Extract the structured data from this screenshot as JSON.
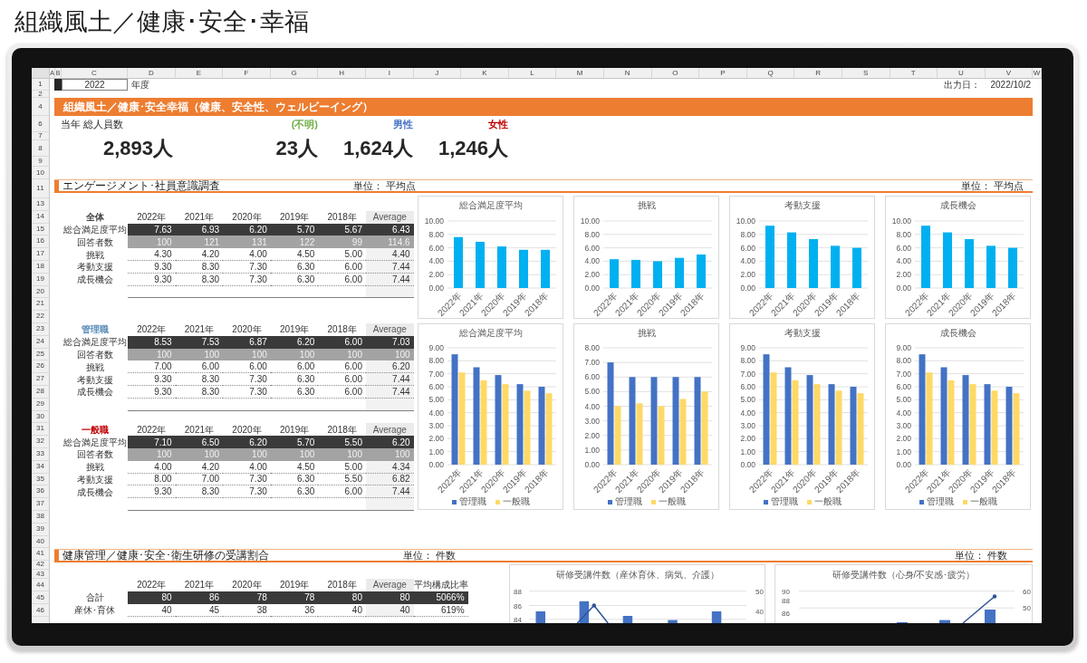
{
  "page_title": "組織風土／健康･安全･幸福",
  "sheet": {
    "columns": [
      "A",
      "B",
      "C",
      "D",
      "E",
      "F",
      "G",
      "H",
      "I",
      "J",
      "K",
      "L",
      "M",
      "N",
      "O",
      "P",
      "Q",
      "R",
      "S",
      "T",
      "U",
      "V",
      "W"
    ],
    "rows": [
      "1",
      "2",
      "4",
      "6",
      "7",
      "8",
      "9",
      "10",
      "11",
      "13",
      "14",
      "15",
      "16",
      "17",
      "18",
      "19",
      "20",
      "21",
      "22",
      "23",
      "24",
      "25",
      "26",
      "27",
      "28",
      "29",
      "30",
      "31",
      "32",
      "33",
      "34",
      "35",
      "36",
      "37",
      "38",
      "39",
      "40",
      "41",
      "42",
      "43",
      "44",
      "45",
      "46"
    ],
    "year": "2022",
    "year_label": "年度",
    "output_date_label": "出力日：",
    "output_date": "2022/10/2",
    "banner": "組織風土／健康･安全幸福（健康、安全性、ウェルビーイング）",
    "headcount": [
      {
        "kind": "total",
        "label": "当年 総人員数",
        "value": "2,893人"
      },
      {
        "kind": "group",
        "label": "(不明)",
        "value": "23人",
        "color": "#70ad47"
      },
      {
        "kind": "group",
        "label": "男性",
        "value": "1,624人",
        "color": "#4472c4"
      },
      {
        "kind": "group",
        "label": "女性",
        "value": "1,246人",
        "color": "#c00000"
      }
    ],
    "sections": [
      {
        "title": "エンゲージメント･社員意識調査",
        "units": [
          "単位： 平均点",
          "単位： 平均点"
        ],
        "tables": [
          {
            "label": "全体",
            "color": "#404040",
            "footer_rule": true,
            "columns": [
              {
                "label": "2022年",
                "shaded": false
              },
              {
                "label": "2021年",
                "shaded": false
              },
              {
                "label": "2020年",
                "shaded": false
              },
              {
                "label": "2019年",
                "shaded": false
              },
              {
                "label": "2018年",
                "shaded": false
              },
              {
                "label": "Average",
                "shaded": true
              }
            ],
            "rows": [
              {
                "kind": "total",
                "label": "総合満足度平均",
                "cells": [
                  "7.63",
                  "6.93",
                  "6.20",
                  "5.70",
                  "5.67",
                  "6.43"
                ]
              },
              {
                "kind": "count",
                "label": "回答者数",
                "cells": [
                  "100",
                  "121",
                  "131",
                  "122",
                  "99",
                  "114.6"
                ]
              },
              {
                "kind": "item",
                "label": "挑戦",
                "cells": [
                  "4.30",
                  "4.20",
                  "4.00",
                  "4.50",
                  "5.00",
                  "4.40"
                ]
              },
              {
                "kind": "item",
                "label": "考動支援",
                "cells": [
                  "9.30",
                  "8.30",
                  "7.30",
                  "6.30",
                  "6.00",
                  "7.44"
                ]
              },
              {
                "kind": "item",
                "label": "成長機会",
                "cells": [
                  "9.30",
                  "8.30",
                  "7.30",
                  "6.30",
                  "6.00",
                  "7.44"
                ]
              }
            ]
          },
          {
            "label": "管理職",
            "color": "#5b8db8",
            "footer_rule": true,
            "columns": [
              {
                "label": "2022年",
                "shaded": false
              },
              {
                "label": "2021年",
                "shaded": false
              },
              {
                "label": "2020年",
                "shaded": false
              },
              {
                "label": "2019年",
                "shaded": false
              },
              {
                "label": "2018年",
                "shaded": false
              },
              {
                "label": "Average",
                "shaded": true
              }
            ],
            "rows": [
              {
                "kind": "total",
                "label": "総合満足度平均",
                "cells": [
                  "8.53",
                  "7.53",
                  "6.87",
                  "6.20",
                  "6.00",
                  "7.03"
                ]
              },
              {
                "kind": "count",
                "label": "回答者数",
                "cells": [
                  "100",
                  "100",
                  "100",
                  "100",
                  "100",
                  "100"
                ]
              },
              {
                "kind": "item",
                "label": "挑戦",
                "cells": [
                  "7.00",
                  "6.00",
                  "6.00",
                  "6.00",
                  "6.00",
                  "6.20"
                ]
              },
              {
                "kind": "item",
                "label": "考動支援",
                "cells": [
                  "9.30",
                  "8.30",
                  "7.30",
                  "6.30",
                  "6.00",
                  "7.44"
                ]
              },
              {
                "kind": "item",
                "label": "成長機会",
                "cells": [
                  "9.30",
                  "8.30",
                  "7.30",
                  "6.30",
                  "6.00",
                  "7.44"
                ]
              }
            ]
          },
          {
            "label": "一般職",
            "color": "#c00000",
            "footer_rule": true,
            "columns": [
              {
                "label": "2022年",
                "shaded": false
              },
              {
                "label": "2021年",
                "shaded": false
              },
              {
                "label": "2020年",
                "shaded": false
              },
              {
                "label": "2019年",
                "shaded": false
              },
              {
                "label": "2018年",
                "shaded": false
              },
              {
                "label": "Average",
                "shaded": true
              }
            ],
            "rows": [
              {
                "kind": "total",
                "label": "総合満足度平均",
                "cells": [
                  "7.10",
                  "6.50",
                  "6.20",
                  "5.70",
                  "5.50",
                  "6.20"
                ]
              },
              {
                "kind": "count",
                "label": "回答者数",
                "cells": [
                  "100",
                  "100",
                  "100",
                  "100",
                  "100",
                  "100"
                ]
              },
              {
                "kind": "item",
                "label": "挑戦",
                "cells": [
                  "4.00",
                  "4.20",
                  "4.00",
                  "4.50",
                  "5.00",
                  "4.34"
                ]
              },
              {
                "kind": "item",
                "label": "考動支援",
                "cells": [
                  "8.00",
                  "7.00",
                  "7.30",
                  "6.30",
                  "5.50",
                  "6.82"
                ]
              },
              {
                "kind": "item",
                "label": "成長機会",
                "cells": [
                  "9.30",
                  "8.30",
                  "7.30",
                  "6.30",
                  "6.00",
                  "7.44"
                ]
              }
            ]
          }
        ],
        "charts": [
          {
            "kind": "bar",
            "chart_data": {
              "type": "bar",
              "title": "総合満足度平均",
              "categories": [
                "2022年",
                "2021年",
                "2020年",
                "2019年",
                "2018年"
              ],
              "values": [
                7.6,
                6.9,
                6.2,
                5.7,
                5.7
              ],
              "ylim": [
                0,
                10
              ],
              "yticks": [
                {
                  "value": 0,
                  "label": "0.00"
                },
                {
                  "value": 2,
                  "label": "2.00"
                },
                {
                  "value": 4,
                  "label": "4.00"
                },
                {
                  "value": 6,
                  "label": "6.00"
                },
                {
                  "value": 8,
                  "label": "8.00"
                },
                {
                  "value": 10,
                  "label": "10.00"
                }
              ],
              "grid": true
            }
          },
          {
            "kind": "bar",
            "chart_data": {
              "type": "bar",
              "title": "挑戦",
              "categories": [
                "2022年",
                "2021年",
                "2020年",
                "2019年",
                "2018年"
              ],
              "values": [
                4.3,
                4.2,
                4.0,
                4.5,
                5.0
              ],
              "ylim": [
                0,
                10
              ],
              "yticks": [
                {
                  "value": 0,
                  "label": "0.00"
                },
                {
                  "value": 2,
                  "label": "2.00"
                },
                {
                  "value": 4,
                  "label": "4.00"
                },
                {
                  "value": 6,
                  "label": "6.00"
                },
                {
                  "value": 8,
                  "label": "8.00"
                },
                {
                  "value": 10,
                  "label": "10.00"
                }
              ],
              "grid": true
            }
          },
          {
            "kind": "bar",
            "chart_data": {
              "type": "bar",
              "title": "考動支援",
              "categories": [
                "2022年",
                "2021年",
                "2020年",
                "2019年",
                "2018年"
              ],
              "values": [
                9.3,
                8.3,
                7.3,
                6.3,
                6.0
              ],
              "ylim": [
                0,
                10
              ],
              "yticks": [
                {
                  "value": 0,
                  "label": "0.00"
                },
                {
                  "value": 2,
                  "label": "2.00"
                },
                {
                  "value": 4,
                  "label": "4.00"
                },
                {
                  "value": 6,
                  "label": "6.00"
                },
                {
                  "value": 8,
                  "label": "8.00"
                },
                {
                  "value": 10,
                  "label": "10.00"
                }
              ],
              "grid": true
            }
          },
          {
            "kind": "bar",
            "chart_data": {
              "type": "bar",
              "title": "成長機会",
              "categories": [
                "2022年",
                "2021年",
                "2020年",
                "2019年",
                "2018年"
              ],
              "values": [
                9.3,
                8.3,
                7.3,
                6.3,
                6.0
              ],
              "ylim": [
                0,
                10
              ],
              "yticks": [
                {
                  "value": 0,
                  "label": "0.00"
                },
                {
                  "value": 2,
                  "label": "2.00"
                },
                {
                  "value": 4,
                  "label": "4.00"
                },
                {
                  "value": 6,
                  "label": "6.00"
                },
                {
                  "value": 8,
                  "label": "8.00"
                },
                {
                  "value": 10,
                  "label": "10.00"
                }
              ],
              "grid": true
            }
          },
          {
            "kind": "grouped",
            "chart_data": {
              "type": "bar",
              "title": "総合満足度平均",
              "categories": [
                "2022年",
                "2021年",
                "2020年",
                "2019年",
                "2018年"
              ],
              "series": [
                {
                  "name": "管理職",
                  "color": "#4472c4",
                  "values": [
                    8.5,
                    7.5,
                    6.9,
                    6.2,
                    6.0
                  ]
                },
                {
                  "name": "一般職",
                  "color": "#ffd966",
                  "values": [
                    7.1,
                    6.5,
                    6.2,
                    5.7,
                    5.5
                  ]
                }
              ],
              "ylim": [
                0,
                9
              ],
              "yticks": [
                {
                  "value": 0,
                  "label": "0.00"
                },
                {
                  "value": 1,
                  "label": "1.00"
                },
                {
                  "value": 2,
                  "label": "2.00"
                },
                {
                  "value": 3,
                  "label": "3.00"
                },
                {
                  "value": 4,
                  "label": "4.00"
                },
                {
                  "value": 5,
                  "label": "5.00"
                },
                {
                  "value": 6,
                  "label": "6.00"
                },
                {
                  "value": 7,
                  "label": "7.00"
                },
                {
                  "value": 8,
                  "label": "8.00"
                },
                {
                  "value": 9,
                  "label": "9.00"
                }
              ],
              "grid": true,
              "legend": "bottom"
            }
          },
          {
            "kind": "grouped",
            "chart_data": {
              "type": "bar",
              "title": "挑戦",
              "categories": [
                "2022年",
                "2021年",
                "2020年",
                "2019年",
                "2018年"
              ],
              "series": [
                {
                  "name": "管理職",
                  "color": "#4472c4",
                  "values": [
                    7.0,
                    6.0,
                    6.0,
                    6.0,
                    6.0
                  ]
                },
                {
                  "name": "一般職",
                  "color": "#ffd966",
                  "values": [
                    4.0,
                    4.2,
                    4.0,
                    4.5,
                    5.0
                  ]
                }
              ],
              "ylim": [
                0,
                8
              ],
              "yticks": [
                {
                  "value": 0,
                  "label": "0.00"
                },
                {
                  "value": 1,
                  "label": "1.00"
                },
                {
                  "value": 2,
                  "label": "2.00"
                },
                {
                  "value": 3,
                  "label": "3.00"
                },
                {
                  "value": 4,
                  "label": "4.00"
                },
                {
                  "value": 5,
                  "label": "5.00"
                },
                {
                  "value": 6,
                  "label": "6.00"
                },
                {
                  "value": 7,
                  "label": "7.00"
                },
                {
                  "value": 8,
                  "label": "8.00"
                }
              ],
              "grid": true,
              "legend": "bottom"
            }
          },
          {
            "kind": "grouped",
            "chart_data": {
              "type": "bar",
              "title": "考動支援",
              "categories": [
                "2022年",
                "2021年",
                "2020年",
                "2019年",
                "2018年"
              ],
              "series": [
                {
                  "name": "管理職",
                  "color": "#4472c4",
                  "values": [
                    8.5,
                    7.5,
                    6.9,
                    6.2,
                    6.0
                  ]
                },
                {
                  "name": "一般職",
                  "color": "#ffd966",
                  "values": [
                    7.1,
                    6.5,
                    6.2,
                    5.7,
                    5.5
                  ]
                }
              ],
              "ylim": [
                0,
                9
              ],
              "yticks": [
                {
                  "value": 0,
                  "label": "0.00"
                },
                {
                  "value": 1,
                  "label": "1.00"
                },
                {
                  "value": 2,
                  "label": "2.00"
                },
                {
                  "value": 3,
                  "label": "3.00"
                },
                {
                  "value": 4,
                  "label": "4.00"
                },
                {
                  "value": 5,
                  "label": "5.00"
                },
                {
                  "value": 6,
                  "label": "6.00"
                },
                {
                  "value": 7,
                  "label": "7.00"
                },
                {
                  "value": 8,
                  "label": "8.00"
                },
                {
                  "value": 9,
                  "label": "9.00"
                }
              ],
              "grid": true,
              "legend": "bottom"
            }
          },
          {
            "kind": "grouped",
            "chart_data": {
              "type": "bar",
              "title": "成長機会",
              "categories": [
                "2022年",
                "2021年",
                "2020年",
                "2019年",
                "2018年"
              ],
              "series": [
                {
                  "name": "管理職",
                  "color": "#4472c4",
                  "values": [
                    8.5,
                    7.5,
                    6.9,
                    6.2,
                    6.0
                  ]
                },
                {
                  "name": "一般職",
                  "color": "#ffd966",
                  "values": [
                    7.1,
                    6.5,
                    6.2,
                    5.7,
                    5.5
                  ]
                }
              ],
              "ylim": [
                0,
                9
              ],
              "yticks": [
                {
                  "value": 0,
                  "label": "0.00"
                },
                {
                  "value": 1,
                  "label": "1.00"
                },
                {
                  "value": 2,
                  "label": "2.00"
                },
                {
                  "value": 3,
                  "label": "3.00"
                },
                {
                  "value": 4,
                  "label": "4.00"
                },
                {
                  "value": 5,
                  "label": "5.00"
                },
                {
                  "value": 6,
                  "label": "6.00"
                },
                {
                  "value": 7,
                  "label": "7.00"
                },
                {
                  "value": 8,
                  "label": "8.00"
                },
                {
                  "value": 9,
                  "label": "9.00"
                }
              ],
              "grid": true,
              "legend": "bottom"
            }
          }
        ]
      },
      {
        "title": "健康管理／健康･安全･衛生研修の受講割合",
        "units": [
          "単位： 件数",
          "単位： 件数"
        ],
        "tables": [
          {
            "columns": [
              {
                "label": "2022年",
                "shaded": false
              },
              {
                "label": "2021年",
                "shaded": false
              },
              {
                "label": "2020年",
                "shaded": false
              },
              {
                "label": "2019年",
                "shaded": false
              },
              {
                "label": "2018年",
                "shaded": false
              },
              {
                "label": "Average",
                "shaded": true
              },
              {
                "label": "平均構成比率",
                "shaded": false
              }
            ],
            "rows": [
              {
                "kind": "total",
                "label": "合計",
                "cells": [
                  "80",
                  "86",
                  "78",
                  "78",
                  "80",
                  "80",
                  "5066%"
                ]
              },
              {
                "kind": "item",
                "label": "産休･育休",
                "cells": [
                  "40",
                  "45",
                  "38",
                  "36",
                  "40",
                  "40",
                  "619%"
                ]
              }
            ]
          }
        ],
        "charts": [
          {
            "kind": "combo",
            "title": "研修受講件数（産休育休、病気、介護）",
            "left_ticks": [
              "88",
              "86",
              "84"
            ],
            "right_ticks": [
              "50",
              "40"
            ]
          },
          {
            "kind": "combo",
            "title": "研修受講件数（心身/不安感･疲労）",
            "left_ticks": [
              "90",
              "88",
              "86"
            ],
            "right_ticks": [
              "60",
              "50"
            ]
          }
        ]
      }
    ]
  }
}
